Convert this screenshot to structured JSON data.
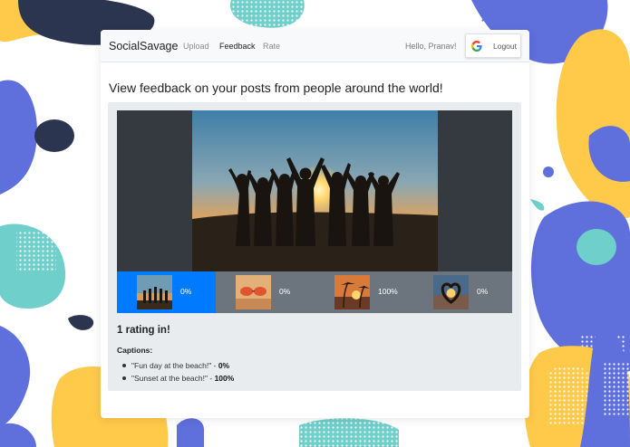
{
  "colors": {
    "bg_blue": "#5f6fdb",
    "bg_navy": "#2c3550",
    "bg_yellow": "#ffc94a",
    "bg_teal": "#6fcfcb",
    "accent": "#007bff",
    "thumb_strip": "#6c757d",
    "viewer_bg": "#343a40",
    "panel_bg": "#e9ecef"
  },
  "navbar": {
    "brand": "SocialSavage",
    "links": [
      {
        "label": "Upload",
        "active": false
      },
      {
        "label": "Feedback",
        "active": true
      },
      {
        "label": "Rate",
        "active": false
      }
    ],
    "greeting": "Hello, Pranav!",
    "logout_label": "Logout",
    "logout_icon": "google-g-icon"
  },
  "main": {
    "heading": "View feedback on your posts from people around the world!",
    "thumbnails": [
      {
        "subject": "group jumping at sunset",
        "percent": "0%",
        "selected": true
      },
      {
        "subject": "sunglasses on sand",
        "percent": "0%",
        "selected": false
      },
      {
        "subject": "palm trees at sunset",
        "percent": "100%",
        "selected": false
      },
      {
        "subject": "heart hands at sunset",
        "percent": "0%",
        "selected": false
      }
    ],
    "rating_count": "1 rating in!",
    "captions_title": "Captions:",
    "captions": [
      {
        "text": "\"Fun day at the beach!\" - ",
        "percent": "0%"
      },
      {
        "text": "\"Sunset at the beach!\" - ",
        "percent": "100%"
      }
    ]
  }
}
